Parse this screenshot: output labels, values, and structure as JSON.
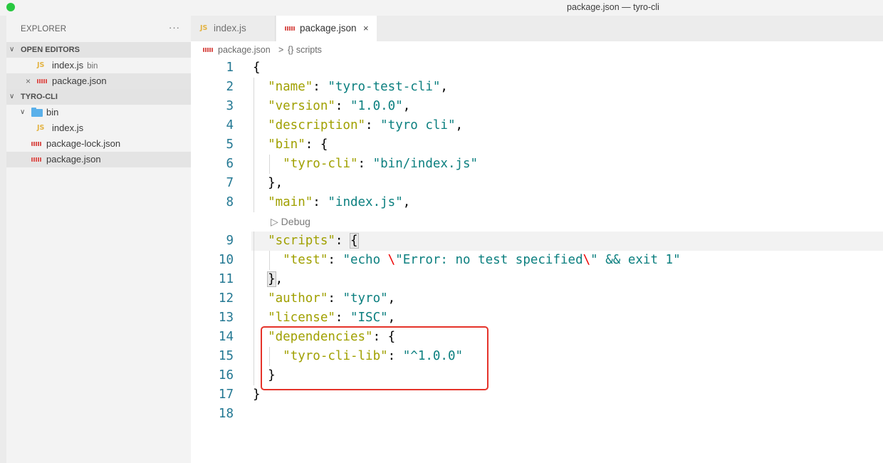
{
  "window": {
    "title": "package.json — tyro-cli"
  },
  "explorer": {
    "header": "EXPLORER",
    "more": "···",
    "open_editors": {
      "label": "OPEN EDITORS",
      "items": [
        {
          "icon": "JS",
          "name": "index.js",
          "desc": "bin"
        },
        {
          "name": "package.json",
          "close": "×"
        }
      ]
    },
    "project": {
      "label": "TYRO-CLI",
      "folder": "bin",
      "files": [
        {
          "icon": "JS",
          "name": "index.js"
        },
        {
          "name": "package-lock.json"
        },
        {
          "name": "package.json"
        }
      ]
    }
  },
  "tabs": [
    {
      "icon": "JS",
      "label": "index.js"
    },
    {
      "label": "package.json",
      "close": "×"
    }
  ],
  "breadcrumb": {
    "file": "package.json",
    "sep": ">",
    "symbol": "{} scripts"
  },
  "editor": {
    "codelens": "Debug",
    "line_numbers": [
      "1",
      "2",
      "3",
      "4",
      "5",
      "6",
      "7",
      "8",
      "9",
      "10",
      "11",
      "12",
      "13",
      "14",
      "15",
      "16",
      "17",
      "18"
    ],
    "lines": {
      "l1": "{",
      "l2_key": "\"name\"",
      "l2_val": "\"tyro-test-cli\"",
      "l3_key": "\"version\"",
      "l3_val": "\"1.0.0\"",
      "l4_key": "\"description\"",
      "l4_val": "\"tyro cli\"",
      "l5_key": "\"bin\"",
      "l6_key": "\"tyro-cli\"",
      "l6_val": "\"bin/index.js\"",
      "l7": "},",
      "l8_key": "\"main\"",
      "l8_val": "\"index.js\"",
      "l9_key": "\"scripts\"",
      "l10_key": "\"test\"",
      "l10_val_a": "\"echo ",
      "l10_esc1": "\\",
      "l10_val_b": "\"Error: no test specified",
      "l10_esc2": "\\",
      "l10_val_c": "\" && exit 1\"",
      "l11_brace": "}",
      "l12_key": "\"author\"",
      "l12_val": "\"tyro\"",
      "l13_key": "\"license\"",
      "l13_val": "\"ISC\"",
      "l14_key": "\"dependencies\"",
      "l15_key": "\"tyro-cli-lib\"",
      "l15_val": "\"^1.0.0\"",
      "l16": "}",
      "l17": "}"
    }
  },
  "colors": {
    "annotation": "#e5332a",
    "line_number": "#237893",
    "json_key": "#a0a000",
    "json_string": "#0b7f7f"
  }
}
